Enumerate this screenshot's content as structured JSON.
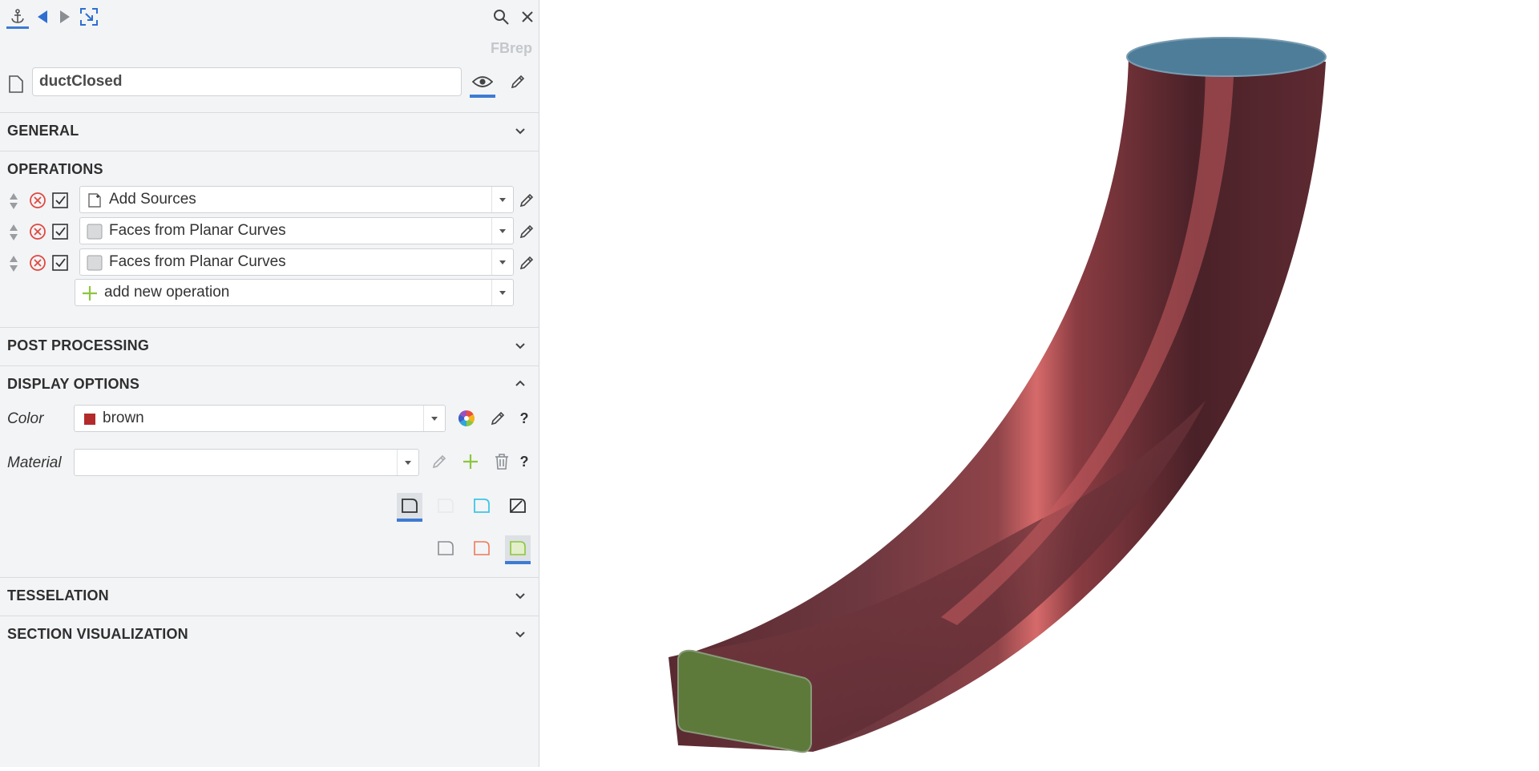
{
  "toolbar": {
    "icons": [
      "anchor-icon",
      "back-arrow-icon",
      "forward-arrow-icon",
      "fit-selection-icon",
      "search-icon",
      "close-icon"
    ],
    "type_badge": "FBrep"
  },
  "object": {
    "name": "ductClosed",
    "icons": [
      "document-icon",
      "eye-icon",
      "pencil-icon"
    ]
  },
  "sections": {
    "general": "GENERAL",
    "operations": "OPERATIONS",
    "post_processing": "POST PROCESSING",
    "display_options": "DISPLAY OPTIONS",
    "tesselation": "TESSELATION",
    "section_visualization": "SECTION VISUALIZATION"
  },
  "operations": [
    {
      "label": "Add Sources",
      "icon": "add-sources-icon",
      "enabled": true
    },
    {
      "label": "Faces from Planar Curves",
      "icon": "gray-square-icon",
      "enabled": true
    },
    {
      "label": "Faces from Planar Curves",
      "icon": "gray-square-icon",
      "enabled": true
    }
  ],
  "add_operation": {
    "label": "add new operation"
  },
  "display": {
    "color_label": "Color",
    "color_value": "brown",
    "color_swatch": "#b22a2a",
    "material_label": "Material",
    "material_value": "",
    "help": "?"
  },
  "viewport": {
    "model": "ductClosed",
    "colors": {
      "body": "#6a2f36",
      "highlight": "#d66a6a",
      "top_face": "#4e7d99",
      "end_face": "#5d7a3a"
    }
  }
}
